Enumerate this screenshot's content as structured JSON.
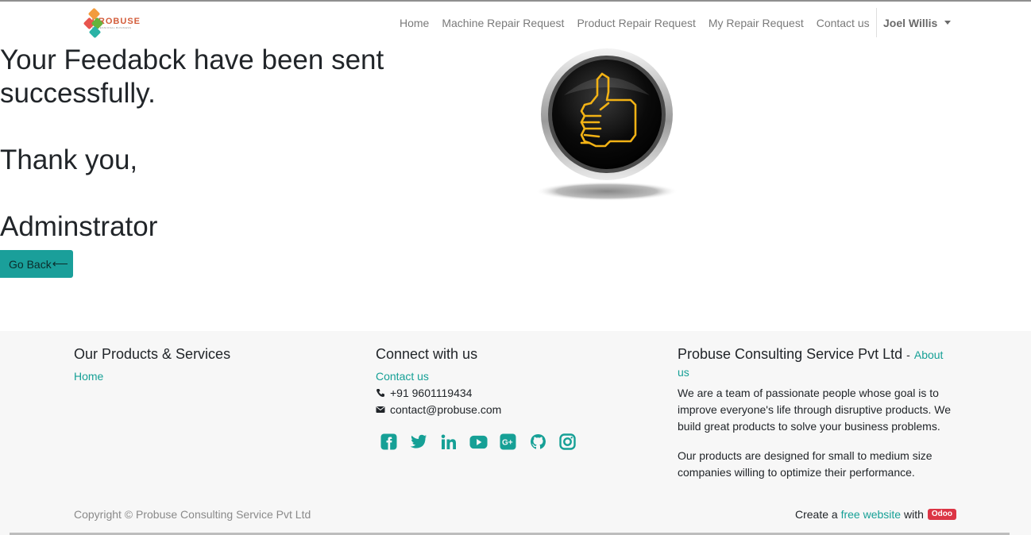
{
  "navbar": {
    "logo_text": "PROBUSE",
    "logo_subtext": "PROFESSIONAL BUSINESS",
    "links": [
      "Home",
      "Machine Repair Request",
      "Product Repair Request",
      "My Repair Request",
      "Contact us"
    ],
    "user_name": "Joel Willis"
  },
  "main": {
    "message_line1": "Your Feedabck have been sent",
    "message_line2": "successfully.",
    "thanks": "Thank you,",
    "signature": "Adminstrator",
    "go_back_label": "Go Back"
  },
  "footer": {
    "products": {
      "title": "Our Products & Services",
      "home_link": "Home"
    },
    "connect": {
      "title": "Connect with us",
      "contact_link": "Contact us",
      "phone": "+91 9601119434",
      "email": "contact@probuse.com",
      "social_icons": [
        "facebook-icon",
        "twitter-icon",
        "linkedin-icon",
        "youtube-icon",
        "google-plus-icon",
        "github-icon",
        "instagram-icon"
      ]
    },
    "about": {
      "company": "Probuse Consulting Service Pvt Ltd",
      "separator": "-",
      "about_link": "About us",
      "paragraph1": "We are a team of passionate people whose goal is to improve everyone's life through disruptive products. We build great products to solve your business problems.",
      "paragraph2": "Our products are designed for small to medium size companies willing to optimize their performance."
    },
    "copyright": "Copyright © Probuse Consulting Service Pvt Ltd",
    "create_prefix": "Create a",
    "create_link": "free website",
    "create_with": "with",
    "odoo_badge": "Odoo"
  },
  "colors": {
    "accent": "#16a096",
    "button": "#1a9f9a",
    "badge": "#dc3545",
    "footer_bg": "#f7f7f7"
  }
}
